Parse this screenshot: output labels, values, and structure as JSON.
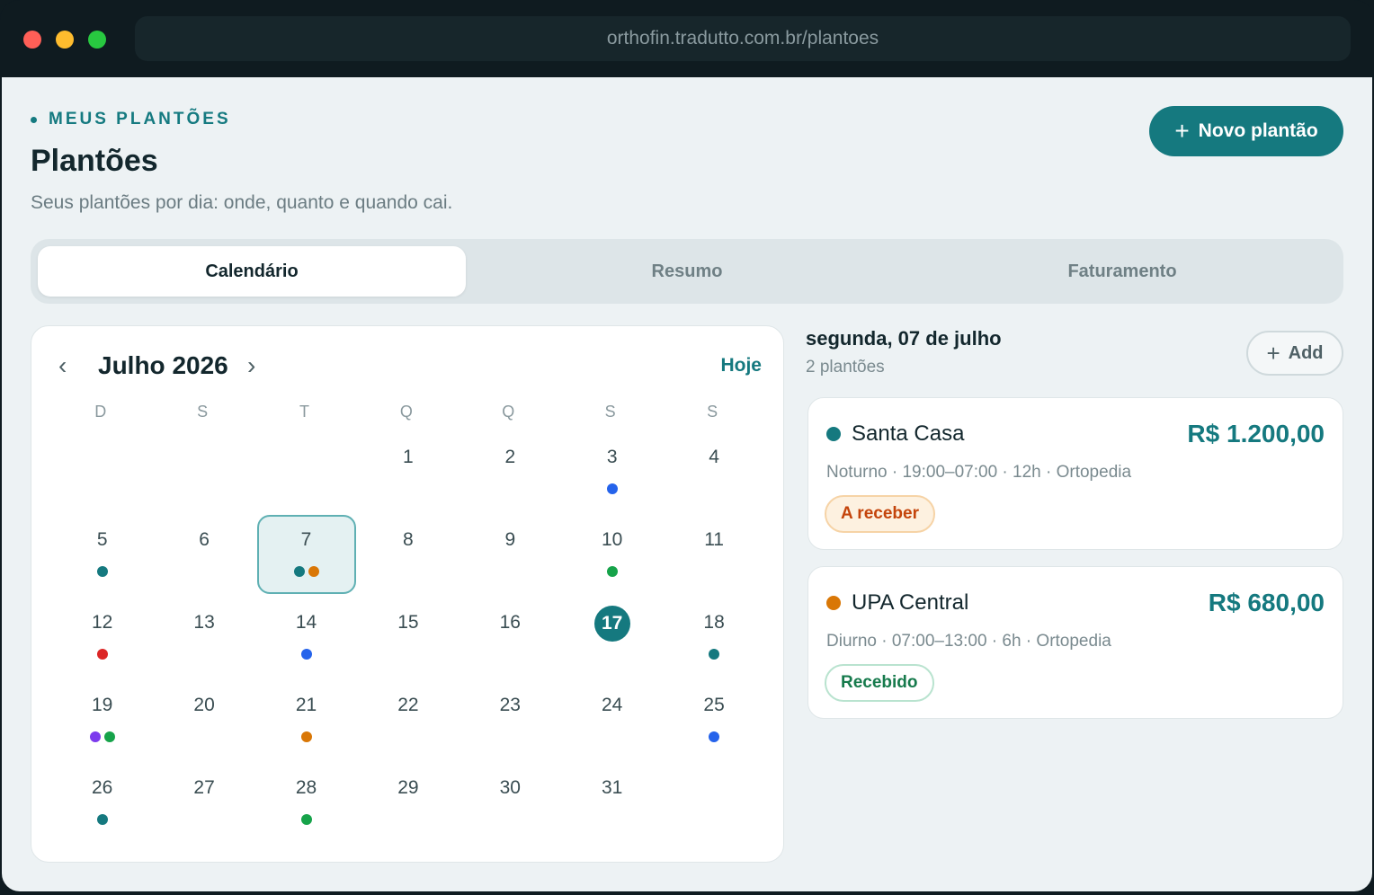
{
  "browser": {
    "url": "orthofin.tradutto.com.br/plantoes"
  },
  "header": {
    "eyebrow": "MEUS PLANTÕES",
    "title": "Plantões",
    "subtitle": "Seus plantões por dia: onde, quanto e quando cai.",
    "new_button": {
      "icon": "plus-icon",
      "label": "Novo plantão"
    }
  },
  "tabs": [
    {
      "label": "Calendário",
      "active": true
    },
    {
      "label": "Resumo",
      "active": false
    },
    {
      "label": "Faturamento",
      "active": false
    }
  ],
  "calendar": {
    "month_label": "Julho 2026",
    "prev_icon": "chevron-left-icon",
    "next_icon": "chevron-right-icon",
    "today_label": "Hoje",
    "weekdays": [
      "D",
      "S",
      "T",
      "Q",
      "Q",
      "S",
      "S"
    ],
    "first_weekday_index": 3,
    "days_in_month": 31,
    "selected_day": 7,
    "today_day": 17,
    "events": {
      "3": [
        "#2563eb"
      ],
      "5": [
        "#15797f"
      ],
      "7": [
        "#15797f",
        "#d97706"
      ],
      "10": [
        "#16a34a"
      ],
      "12": [
        "#dc2626"
      ],
      "14": [
        "#2563eb"
      ],
      "18": [
        "#15797f"
      ],
      "19": [
        "#7c3aed",
        "#16a34a"
      ],
      "21": [
        "#d97706"
      ],
      "25": [
        "#2563eb"
      ],
      "26": [
        "#15797f"
      ],
      "28": [
        "#16a34a"
      ]
    }
  },
  "day_panel": {
    "date_label": "segunda, 07 de julho",
    "count_label": "2 plantões",
    "add_button": {
      "icon": "plus-icon",
      "label": "Add"
    },
    "shifts": [
      {
        "place": "Santa Casa",
        "color": "#15797f",
        "value": "R$ 1.200,00",
        "detail": "Noturno · 19:00–07:00 · 12h · Ortopedia",
        "status": "A receber",
        "status_kind": "pending"
      },
      {
        "place": "UPA Central",
        "color": "#d97706",
        "value": "R$ 680,00",
        "detail": "Diurno · 07:00–13:00 · 6h · Ortopedia",
        "status": "Recebido",
        "status_kind": "paid"
      }
    ]
  },
  "colors": {
    "accent": "#15797f",
    "background": "#edf2f4",
    "titlebar": "#0f1b20"
  }
}
